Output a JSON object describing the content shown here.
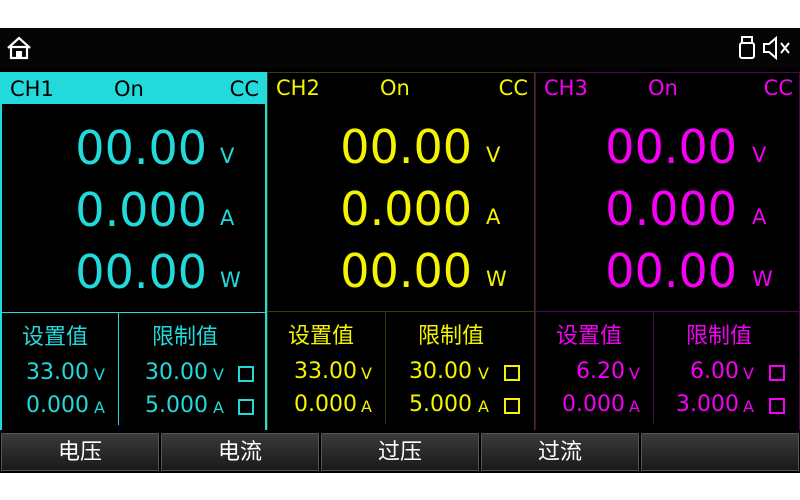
{
  "channels": [
    {
      "name": "CH1",
      "state": "On",
      "mode": "CC",
      "color": "#22dada",
      "voltage": "00.00",
      "current": "0.000",
      "power": "00.00",
      "u_v": "V",
      "u_a": "A",
      "u_w": "W",
      "set_title": "设置值",
      "limit_title": "限制值",
      "set_v": "33.00",
      "set_a": "0.000",
      "lim_v": "30.00",
      "lim_a": "5.000"
    },
    {
      "name": "CH2",
      "state": "On",
      "mode": "CC",
      "color": "#f4f400",
      "voltage": "00.00",
      "current": "0.000",
      "power": "00.00",
      "u_v": "V",
      "u_a": "A",
      "u_w": "W",
      "set_title": "设置值",
      "limit_title": "限制值",
      "set_v": "33.00",
      "set_a": "0.000",
      "lim_v": "30.00",
      "lim_a": "5.000"
    },
    {
      "name": "CH3",
      "state": "On",
      "mode": "CC",
      "color": "#f400f4",
      "voltage": "00.00",
      "current": "0.000",
      "power": "00.00",
      "u_v": "V",
      "u_a": "A",
      "u_w": "W",
      "set_title": "设置值",
      "limit_title": "限制值",
      "set_v": "6.20",
      "set_a": "0.000",
      "lim_v": "6.00",
      "lim_a": "3.000"
    }
  ],
  "softkeys": [
    "电压",
    "电流",
    "过压",
    "过流",
    ""
  ],
  "icons": {
    "home": "home-icon",
    "usb": "usb-icon",
    "speaker": "speaker-muted-icon"
  }
}
